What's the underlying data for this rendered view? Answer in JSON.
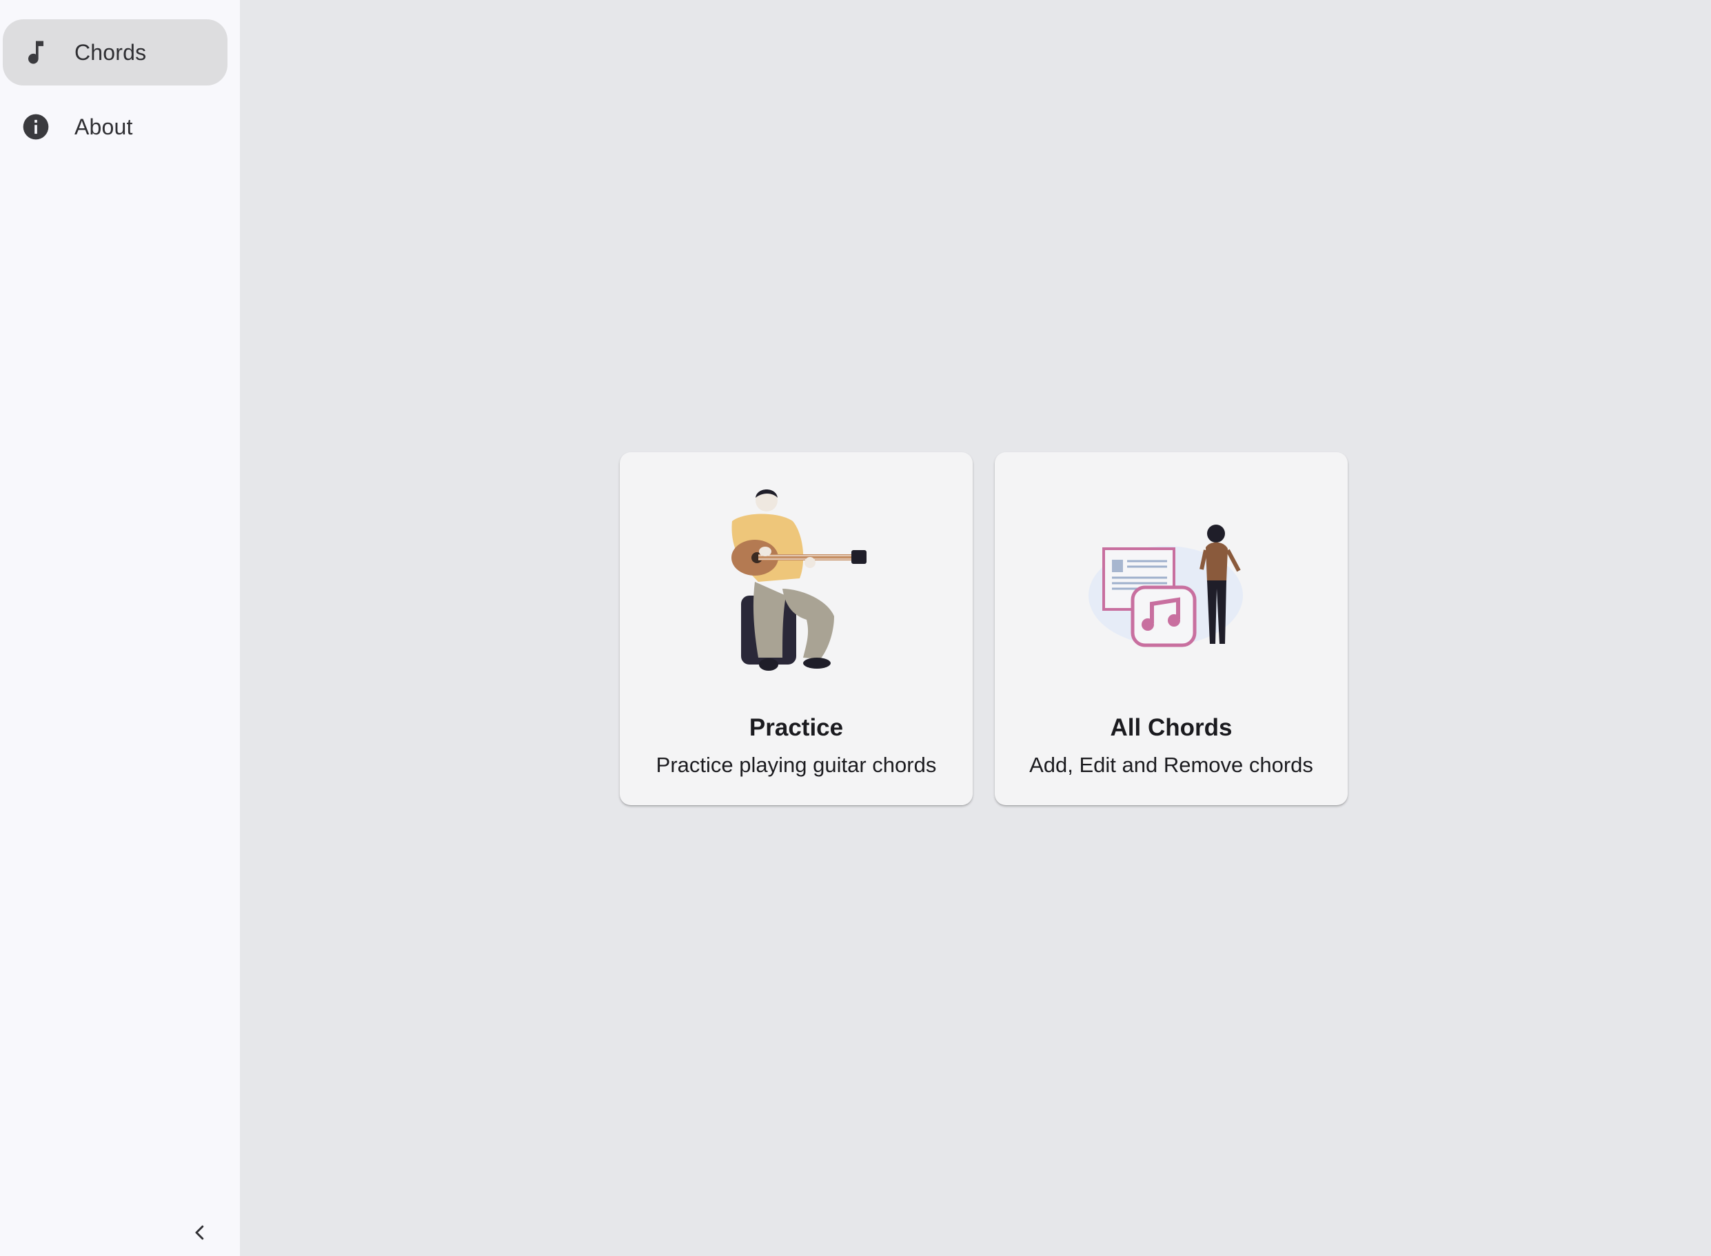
{
  "sidebar": {
    "items": [
      {
        "label": "Chords",
        "icon": "music-note-icon",
        "active": true
      },
      {
        "label": "About",
        "icon": "info-icon",
        "active": false
      }
    ],
    "collapse_icon": "chevron-left-icon"
  },
  "cards": [
    {
      "title": "Practice",
      "subtitle": "Practice playing guitar chords",
      "illustration": "guitar-player-illustration"
    },
    {
      "title": "All Chords",
      "subtitle": "Add, Edit and Remove chords",
      "illustration": "chord-library-illustration"
    }
  ],
  "colors": {
    "background": "#e6e7ea",
    "sidebar": "#f8f8fc",
    "active_item": "#dddddf",
    "card": "#f4f4f5",
    "accent_pink": "#c86f9f"
  }
}
